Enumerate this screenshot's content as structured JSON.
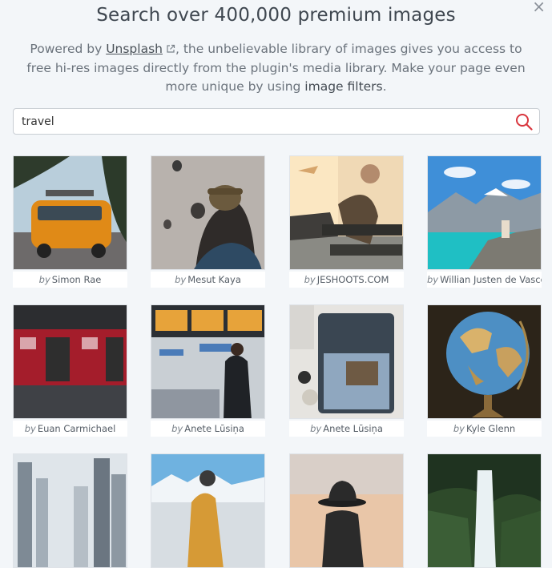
{
  "header": {
    "title": "Search over 400,000 premium images",
    "desc_prefix": "Powered by ",
    "desc_link": "Unsplash",
    "desc_mid": ", the unbelievable library of images gives you access to free hi-res images directly from the plugin's media library. Make your page even more unique by using ",
    "desc_strong": "image filters",
    "desc_suffix": "."
  },
  "close_icon": "×",
  "search": {
    "value": "travel",
    "icon": "search-icon"
  },
  "by_label": "by",
  "images": [
    {
      "author": "Simon Rae",
      "scene": "orange-van"
    },
    {
      "author": "Mesut Kaya",
      "scene": "balloons"
    },
    {
      "author": "JESHOOTS.COM",
      "scene": "airport-seat"
    },
    {
      "author": "Willian Justen de Vasconcellos",
      "scene": "mountain-lake"
    },
    {
      "author": "Euan Carmichael",
      "scene": "red-train"
    },
    {
      "author": "Anete Lūsiņa",
      "scene": "departures"
    },
    {
      "author": "Anete Lūsiņa",
      "scene": "suitcase"
    },
    {
      "author": "Kyle Glenn",
      "scene": "globe"
    },
    {
      "author": "",
      "scene": "city"
    },
    {
      "author": "",
      "scene": "snow-mountains"
    },
    {
      "author": "",
      "scene": "hat-sunset"
    },
    {
      "author": "",
      "scene": "waterfall"
    }
  ],
  "colors": {
    "accent": "#d9363e",
    "background": "#f3f6f9"
  }
}
